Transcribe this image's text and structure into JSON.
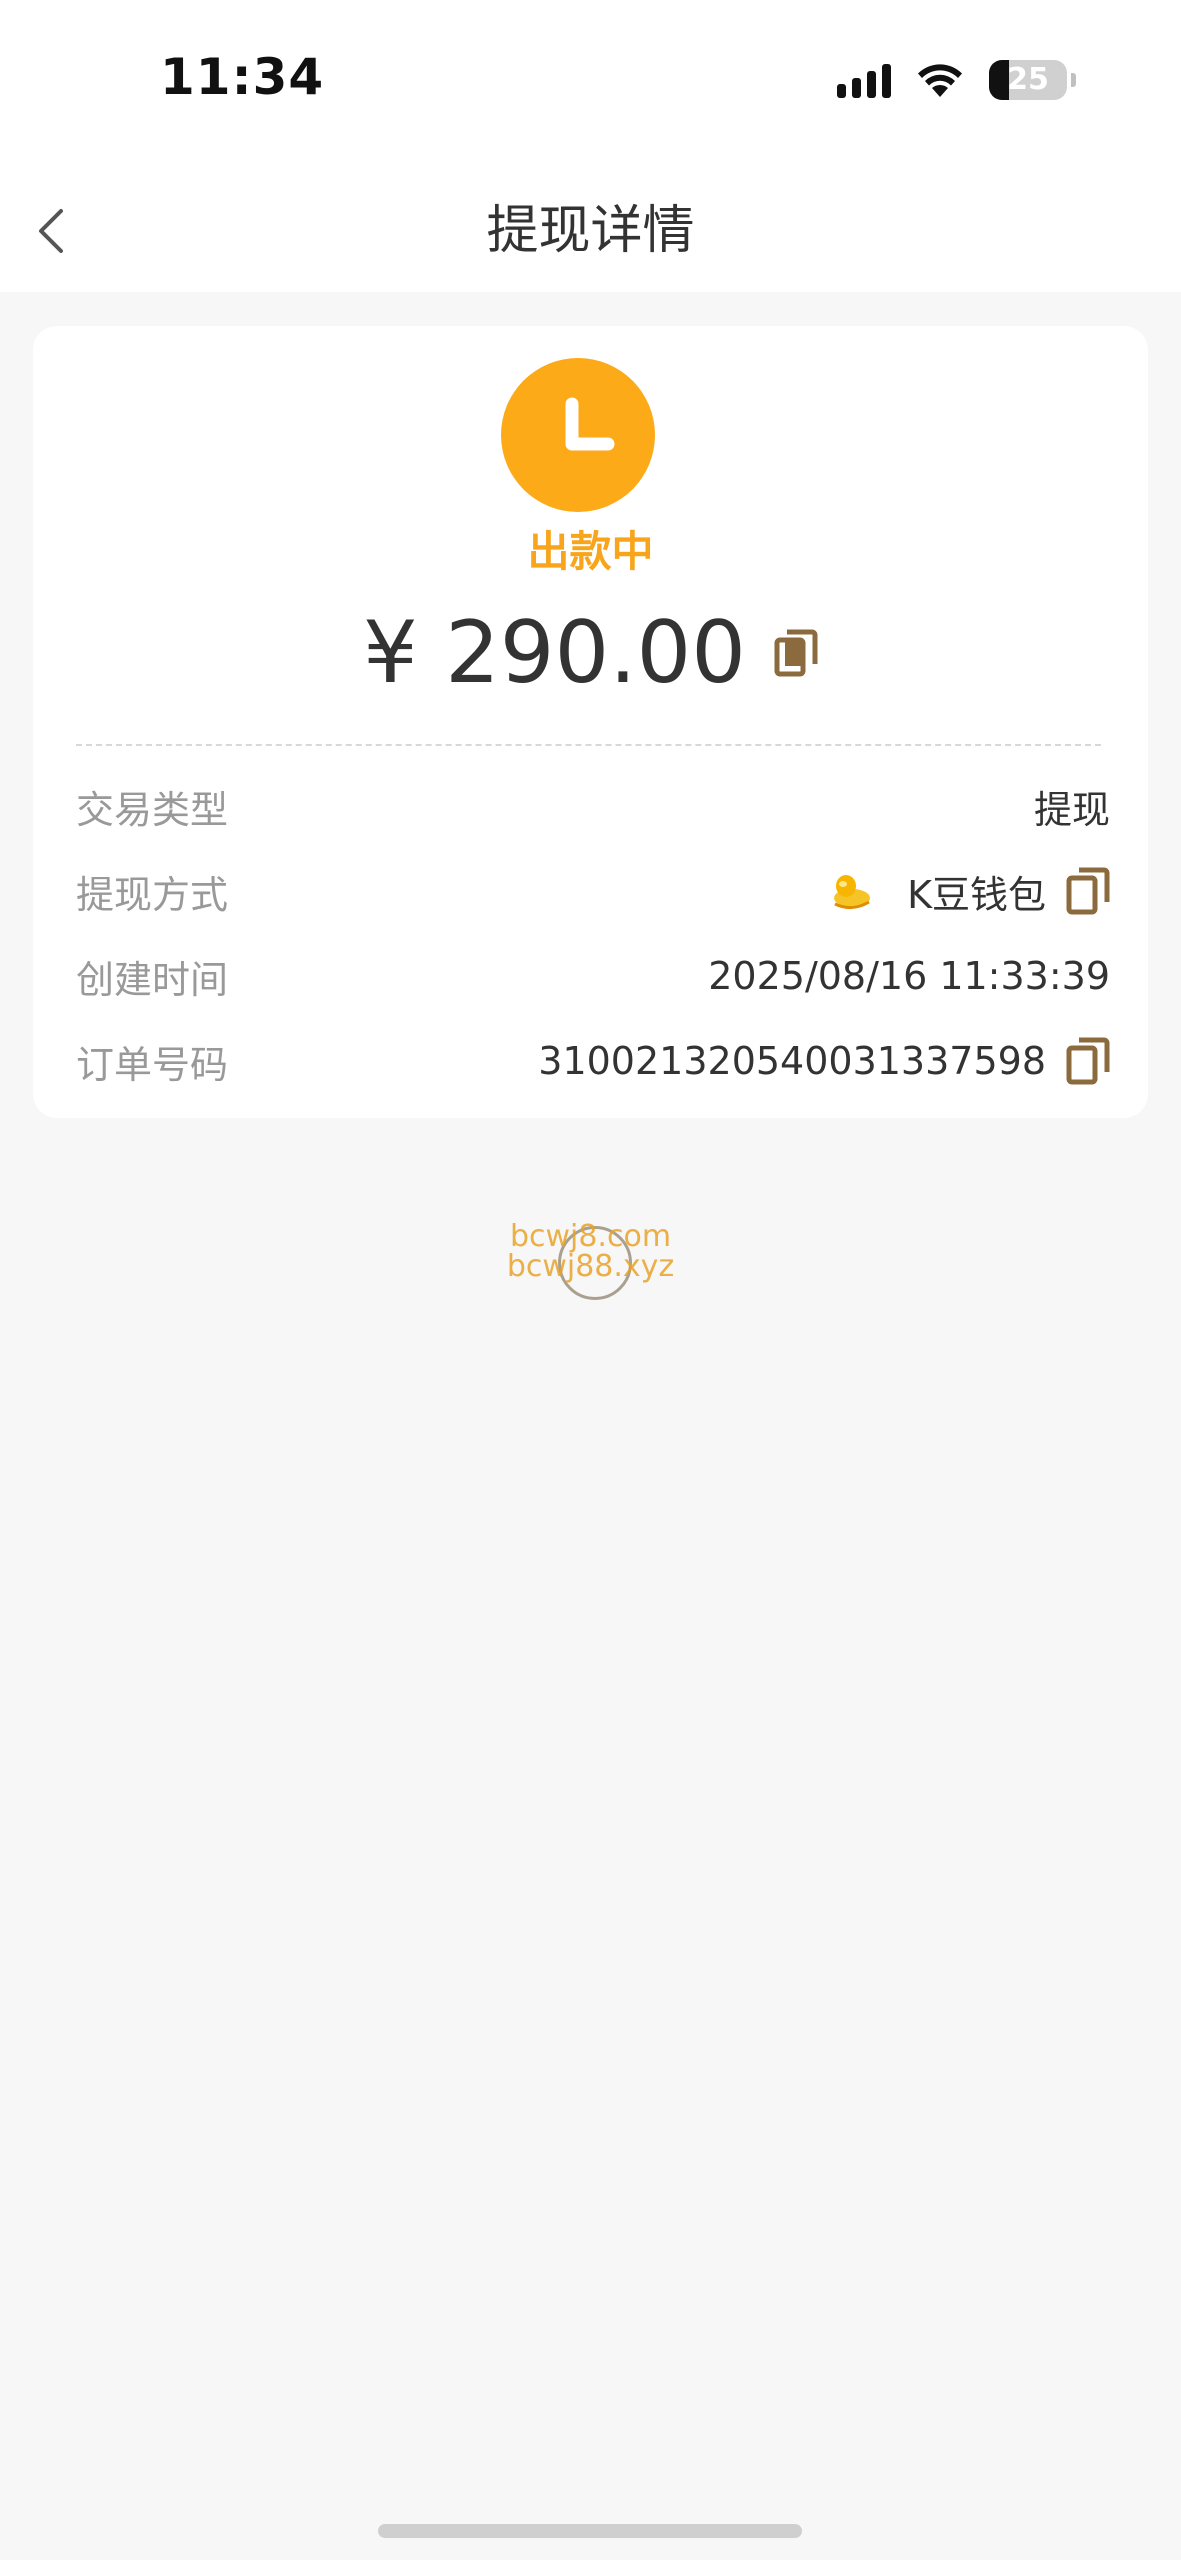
{
  "status_bar": {
    "time": "11:34",
    "battery": "25",
    "battery_level": 0.25
  },
  "nav": {
    "title": "提现详情",
    "back_icon": "chevron-left-icon"
  },
  "status": {
    "icon": "clock-icon",
    "text": "出款中",
    "color": "#FCAA17"
  },
  "amount": {
    "value": "¥ 290.00",
    "copy_icon": "copy-icon"
  },
  "details": {
    "transaction_type": {
      "label": "交易类型",
      "value": "提现"
    },
    "withdraw_method": {
      "label": "提现方式",
      "value": "K豆钱包",
      "icon": "k-bean-logo-icon"
    },
    "created_time": {
      "label": "创建时间",
      "value": "2025/08/16 11:33:39"
    },
    "order_no": {
      "label": "订单号码",
      "value": "3100213205400313375​98"
    }
  },
  "watermark": {
    "line1": "bcwj8.com",
    "line2": "bcwj88.xyz"
  },
  "colors": {
    "accent": "#FCAA17",
    "copy_icon": "#8B6A3E",
    "label": "#999999",
    "text": "#333333"
  }
}
